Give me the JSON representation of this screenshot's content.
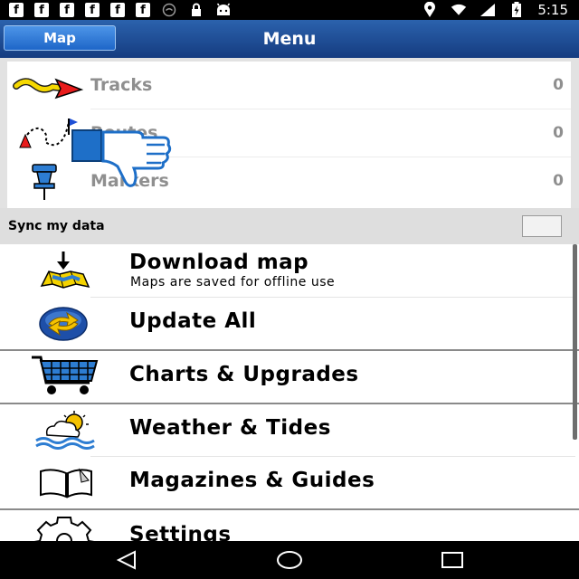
{
  "status_bar": {
    "notification_icons": [
      {
        "icon": "facebook-icon",
        "glyph": "f"
      },
      {
        "icon": "facebook-icon",
        "glyph": "f"
      },
      {
        "icon": "facebook-icon",
        "glyph": "f"
      },
      {
        "icon": "facebook-icon",
        "glyph": "f"
      },
      {
        "icon": "facebook-icon",
        "glyph": "f"
      },
      {
        "icon": "facebook-icon",
        "glyph": "f"
      }
    ],
    "other_icons": [
      "wifi-circle-icon",
      "lock-icon",
      "android-icon"
    ],
    "right_icons": [
      "location-icon",
      "wifi-signal-icon",
      "cell-signal-icon",
      "battery-charging-icon"
    ],
    "time": "5:15"
  },
  "header": {
    "map_button_label": "Map",
    "title": "Menu",
    "colors": {
      "bar_top": "#2b62ad",
      "bar_bottom": "#153c80",
      "button": "#3a80dc"
    }
  },
  "data_list": [
    {
      "label": "Tracks",
      "count": "0",
      "icon": "track-arrow-icon"
    },
    {
      "label": "Routes",
      "count": "0",
      "icon": "route-icon"
    },
    {
      "label": "Markers",
      "count": "0",
      "icon": "pushpin-icon"
    }
  ],
  "overlay": {
    "icon": "thumbs-down-icon"
  },
  "sync": {
    "label": "Sync my data",
    "checked": false
  },
  "menu": [
    {
      "title": "Download map",
      "subtitle": "Maps are saved for offline use",
      "icon": "download-map-icon"
    },
    {
      "title": "Update All",
      "icon": "globe-refresh-icon"
    },
    {
      "title": "Charts & Upgrades",
      "icon": "shopping-cart-icon"
    },
    {
      "title": "Weather & Tides",
      "icon": "weather-sun-cloud-icon"
    },
    {
      "title": "Magazines & Guides",
      "icon": "open-book-icon"
    },
    {
      "title": "Settings",
      "icon": "gear-icon"
    }
  ],
  "nav_bar": [
    "back-icon",
    "home-icon",
    "recents-icon"
  ]
}
